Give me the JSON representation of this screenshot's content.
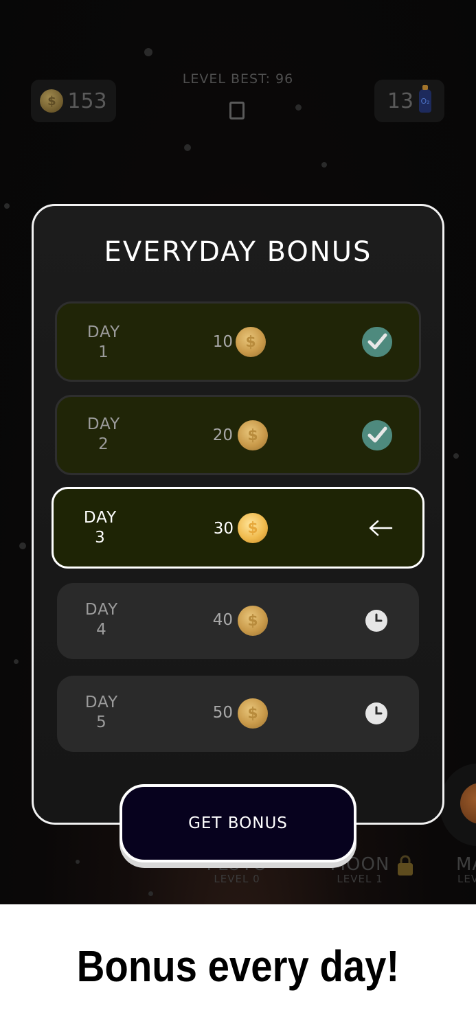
{
  "hud": {
    "coins": "153",
    "level_best": "LEVEL BEST: 96",
    "oxygen": "13",
    "oxygen_icon_label": "O₂",
    "coin_symbol": "$"
  },
  "background": {
    "planet_center_name": "PLUTO",
    "planet_center_level": "LEVEL 0",
    "planet_moon_name": "MOON",
    "planet_moon_level": "LEVEL 1",
    "planet_right_name": "MA",
    "planet_right_level": "LEV"
  },
  "modal": {
    "title": "EVERYDAY BONUS",
    "days": [
      {
        "line1": "DAY",
        "line2": "1",
        "amount": "10",
        "status": "claimed"
      },
      {
        "line1": "DAY",
        "line2": "2",
        "amount": "20",
        "status": "claimed"
      },
      {
        "line1": "DAY",
        "line2": "3",
        "amount": "30",
        "status": "current"
      },
      {
        "line1": "DAY",
        "line2": "4",
        "amount": "40",
        "status": "locked"
      },
      {
        "line1": "DAY",
        "line2": "5",
        "amount": "50",
        "status": "locked"
      }
    ],
    "button": "GET BONUS"
  },
  "caption": "Bonus every day!",
  "colors": {
    "claimed_row": "#202507",
    "current_row": "#1e2405",
    "locked_row": "#2a2a2a",
    "check": "#4e8a7e",
    "button_bg": "#07021e"
  }
}
